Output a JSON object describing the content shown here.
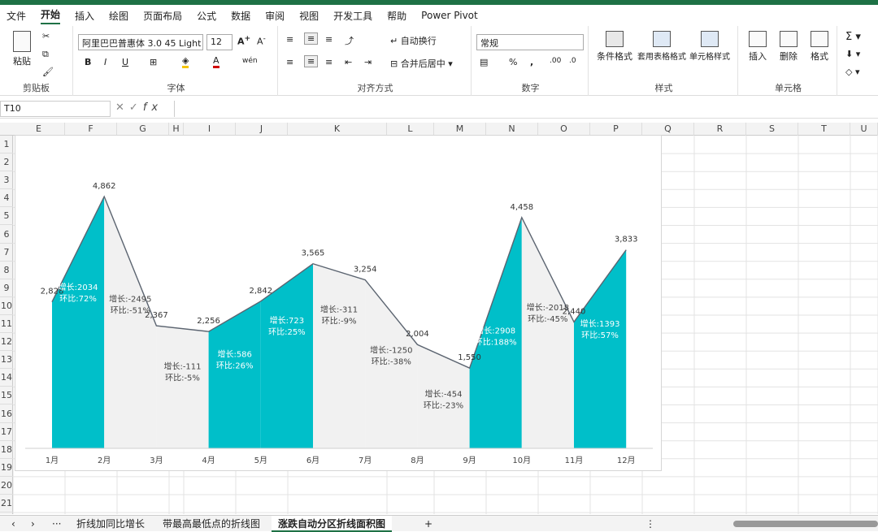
{
  "menu": [
    "文件",
    "开始",
    "插入",
    "绘图",
    "页面布局",
    "公式",
    "数据",
    "审阅",
    "视图",
    "开发工具",
    "帮助",
    "Power Pivot"
  ],
  "menu_active": "开始",
  "ribbon": {
    "paste_label": "粘贴",
    "clipboard_label": "剪贴板",
    "font_name": "阿里巴巴普惠体 3.0 45 Light",
    "font_size": "12",
    "font_label": "字体",
    "wrap_label": "自动换行",
    "merge_label": "合并后居中",
    "align_label": "对齐方式",
    "number_format": "常规",
    "number_label": "数字",
    "cond_format_label": "条件格式",
    "table_format_label": "套用表格格式",
    "cell_style_label": "单元格样式",
    "styles_label": "样式",
    "insert_label": "插入",
    "delete_label": "删除",
    "format_label": "格式",
    "cells_label": "单元格"
  },
  "formula_bar": {
    "name_box": "T10",
    "fx": "fx",
    "content": ""
  },
  "columns": [
    "E",
    "F",
    "G",
    "H",
    "I",
    "J",
    "K",
    "L",
    "M",
    "N",
    "O",
    "P",
    "Q",
    "R",
    "S",
    "T",
    "U"
  ],
  "rows": [
    "1",
    "2",
    "3",
    "4",
    "5",
    "6",
    "7",
    "8",
    "9",
    "10",
    "11",
    "12",
    "13",
    "14",
    "15",
    "16",
    "17",
    "18",
    "19",
    "20",
    "21"
  ],
  "chart_data": {
    "type": "area",
    "categories": [
      "1月",
      "2月",
      "3月",
      "4月",
      "5月",
      "6月",
      "7月",
      "8月",
      "9月",
      "10月",
      "11月",
      "12月"
    ],
    "values": [
      2828,
      4862,
      2367,
      2256,
      2842,
      3565,
      3254,
      2004,
      1550,
      4458,
      2440,
      3833
    ],
    "value_labels": [
      "2,828",
      "4,862",
      "2,367",
      "2,256",
      "2,842",
      "3,565",
      "3,254",
      "2,004",
      "1,550",
      "4,458",
      "2,440",
      "3,833"
    ],
    "segment_labels": [
      {
        "growth": "增长:2034",
        "ratio": "环比:72%"
      },
      {
        "growth": "增长:-2495",
        "ratio": "环比:-51%"
      },
      {
        "growth": "增长:-111",
        "ratio": "环比:-5%"
      },
      {
        "growth": "增长:586",
        "ratio": "环比:26%"
      },
      {
        "growth": "增长:723",
        "ratio": "环比:25%"
      },
      {
        "growth": "增长:-311",
        "ratio": "环比:-9%"
      },
      {
        "growth": "增长:-1250",
        "ratio": "环比:-38%"
      },
      {
        "growth": "增长:-454",
        "ratio": "环比:-23%"
      },
      {
        "growth": "增长:2908",
        "ratio": "环比:188%"
      },
      {
        "growth": "增长:-2018",
        "ratio": "环比:-45%"
      },
      {
        "growth": "增长:1393",
        "ratio": "环比:57%"
      }
    ],
    "colors": {
      "up": "#00bfc9",
      "down": "#f1f1f1",
      "line": "#5b6470"
    },
    "ylim": [
      0,
      5200
    ],
    "grid": false
  },
  "sheet_tabs": [
    "折线加同比增长",
    "带最高最低点的折线图",
    "涨跌自动分区折线面积图"
  ],
  "active_sheet": "涨跌自动分区折线面积图",
  "tab_add": "+",
  "tab_more": "···"
}
